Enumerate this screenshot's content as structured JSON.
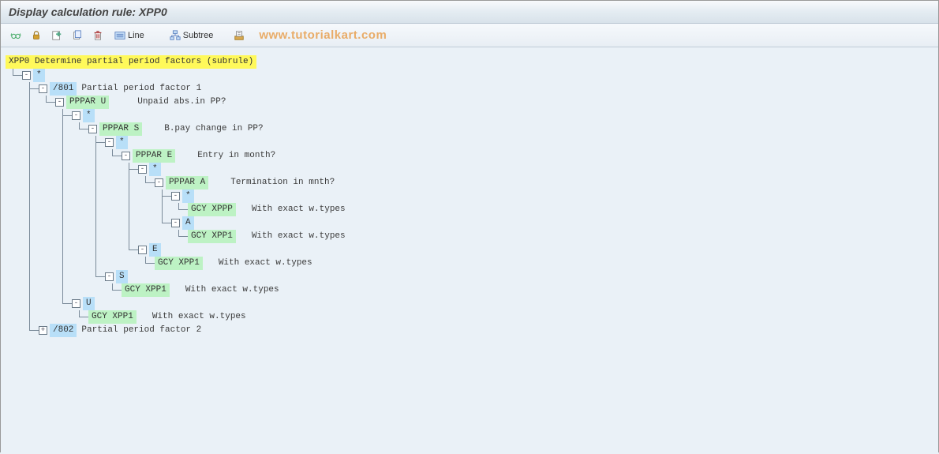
{
  "title": "Display calculation rule: XPP0",
  "toolbar": {
    "line_label": "Line",
    "subtree_label": "Subtree"
  },
  "watermark": "www.tutorialkart.com",
  "tree": {
    "root": {
      "code": "XPP0",
      "desc": "Determine partial period factors (subrule)"
    },
    "n_star1": "*",
    "n_801": {
      "code": "/801",
      "desc": "Partial period factor 1"
    },
    "n_ppparU": {
      "code": "PPPAR U",
      "desc": "Unpaid abs.in PP?"
    },
    "n_star2": "*",
    "n_ppparS": {
      "code": "PPPAR S",
      "desc": "B.pay change in PP?"
    },
    "n_star3": "*",
    "n_ppparE": {
      "code": "PPPAR E",
      "desc": "Entry in month?"
    },
    "n_star4": "*",
    "n_ppparA": {
      "code": "PPPAR A",
      "desc": "Termination in mnth?"
    },
    "n_star5": "*",
    "n_gcyXppp": {
      "code": "GCY XPPP",
      "desc": "With exact w.types"
    },
    "n_A": "A",
    "n_gcyXpp1_a": {
      "code": "GCY XPP1",
      "desc": "With exact w.types"
    },
    "n_E": "E",
    "n_gcyXpp1_e": {
      "code": "GCY XPP1",
      "desc": "With exact w.types"
    },
    "n_S": "S",
    "n_gcyXpp1_s": {
      "code": "GCY XPP1",
      "desc": "With exact w.types"
    },
    "n_U": "U",
    "n_gcyXpp1_u": {
      "code": "GCY XPP1",
      "desc": "With exact w.types"
    },
    "n_802": {
      "code": "/802",
      "desc": "Partial period factor 2"
    }
  }
}
